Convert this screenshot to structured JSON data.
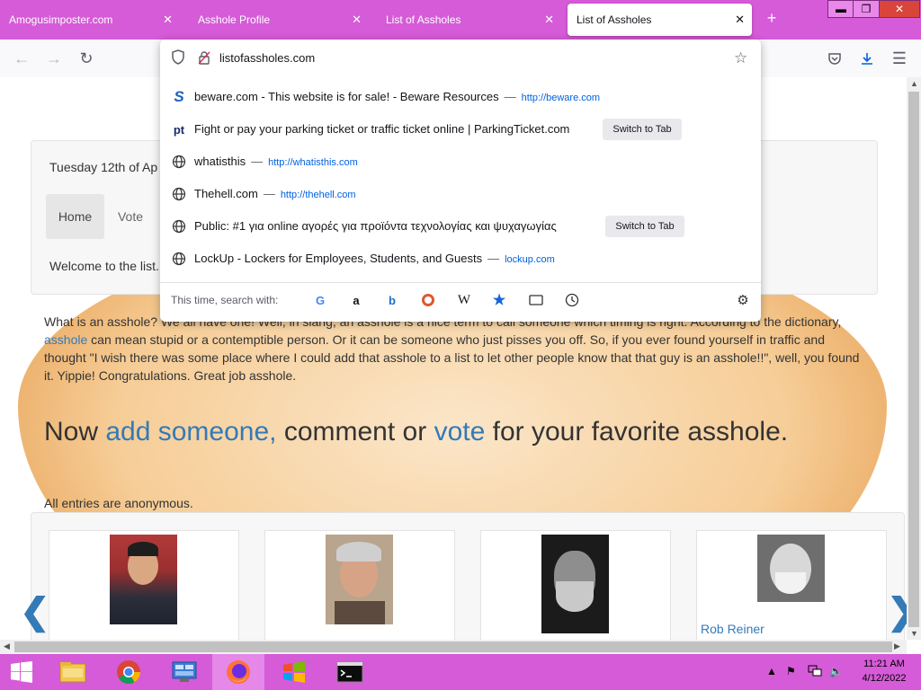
{
  "tabs": [
    {
      "label": "Amogusimposter.com"
    },
    {
      "label": "Asshole Profile"
    },
    {
      "label": "List of Assholes"
    },
    {
      "label": "List of Assholes"
    }
  ],
  "address": {
    "value": "listofassholes.com"
  },
  "suggestions": [
    {
      "title": "beware.com - This website is for sale! - Beware Resources",
      "url": "http://beware.com",
      "switch": ""
    },
    {
      "title": "Fight or pay your parking ticket or traffic ticket online | ParkingTicket.com",
      "url": "",
      "switch": "Switch to Tab"
    },
    {
      "title": "whatisthis",
      "url": "http://whatisthis.com",
      "switch": ""
    },
    {
      "title": "Thehell.com",
      "url": "http://thehell.com",
      "switch": ""
    },
    {
      "title": "Public: #1 για online αγορές για προϊόντα τεχνολογίας και ψυχαγωγίας",
      "url": "",
      "switch": "Switch to Tab"
    },
    {
      "title": "LockUp - Lockers for Employees, Students, and Guests",
      "url": "lockup.com",
      "switch": ""
    }
  ],
  "search_label": "This time, search with:",
  "page": {
    "date": "Tuesday 12th of Ap",
    "nav": {
      "home": "Home",
      "vote": "Vote"
    },
    "welcome": "Welcome to the list.",
    "intro_pre": "What is an asshole? We all have one! Well, in slang, an asshole is a nice term to call someone which timing is right. According to the dictionary, ",
    "intro_link": "asshole",
    "intro_post": " can mean stupid or a contemptible person. Or it can be someone who just pisses you off. So, if you ever found yourself in traffic and thought \"I wish there was some place where I could add that asshole to a list to let other people know that that guy is an asshole!!\", well, you found it. Yippie! Congratulations. Great job asshole.",
    "headline": {
      "a": "Now ",
      "b": "add someone,",
      "c": " comment or ",
      "d": "vote",
      "e": " for your favorite asshole."
    },
    "anonymous": "All entries are anonymous.",
    "card_name": "Rob Reiner"
  },
  "taskbar": {
    "time": "11:21 AM",
    "date": "4/12/2022"
  },
  "colors": {
    "accent": "#d65bd8",
    "link": "#337ab7"
  }
}
